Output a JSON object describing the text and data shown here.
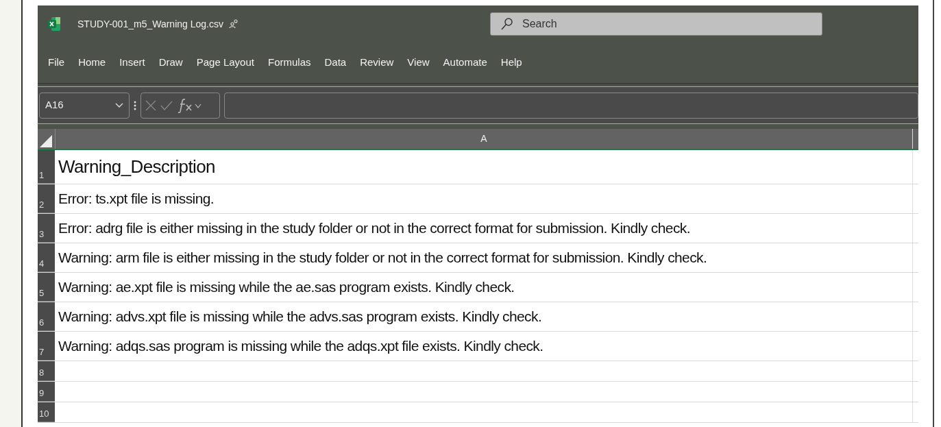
{
  "window": {
    "title": "STUDY-001_m5_Warning Log.csv"
  },
  "search": {
    "placeholder": "Search"
  },
  "menu": [
    "File",
    "Home",
    "Insert",
    "Draw",
    "Page Layout",
    "Formulas",
    "Data",
    "Review",
    "View",
    "Automate",
    "Help"
  ],
  "name_box": {
    "value": "A16"
  },
  "columns": [
    "A"
  ],
  "rows": [
    {
      "number": "1",
      "kind": "heading",
      "cell": "Warning_Description"
    },
    {
      "number": "2",
      "kind": "text",
      "cell": "Error: ts.xpt file is missing."
    },
    {
      "number": "3",
      "kind": "text",
      "cell": "Error: adrg file is either missing in the study folder or not in the correct format for submission. Kindly check."
    },
    {
      "number": "4",
      "kind": "text",
      "cell": "Warning: arm file is either missing in the study folder or not in the correct format for submission. Kindly check."
    },
    {
      "number": "5",
      "kind": "text",
      "cell": "Warning: ae.xpt file is missing while the ae.sas program exists. Kindly check."
    },
    {
      "number": "6",
      "kind": "text",
      "cell": "Warning: advs.xpt file is missing while the advs.sas program exists. Kindly check."
    },
    {
      "number": "7",
      "kind": "text",
      "cell": "Warning: adqs.sas program is missing while the adqs.xpt file exists. Kindly check."
    },
    {
      "number": "8",
      "kind": "empty"
    },
    {
      "number": "9",
      "kind": "empty"
    },
    {
      "number": "10",
      "kind": "empty"
    }
  ]
}
